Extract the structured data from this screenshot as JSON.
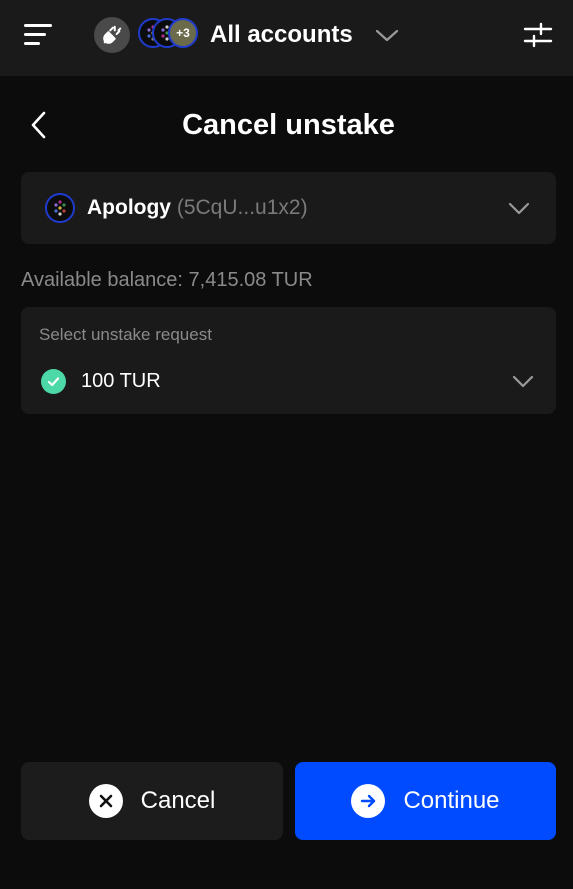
{
  "header": {
    "title": "All accounts",
    "more_accounts_badge": "+3",
    "icons": [
      "menu-icon",
      "plug-icon",
      "chevron-down-icon",
      "sliders-icon"
    ]
  },
  "page": {
    "title": "Cancel unstake"
  },
  "account": {
    "name": "Apology",
    "address": "(5CqU...u1x2)"
  },
  "balance": {
    "text": "Available balance: 7,415.08 TUR"
  },
  "unstake_request": {
    "label": "Select unstake request",
    "value": "100 TUR"
  },
  "buttons": {
    "cancel_label": "Cancel",
    "continue_label": "Continue"
  },
  "colors": {
    "background": "#0c0c0c",
    "panel": "#1a1a1a",
    "accent": "#004bff",
    "success": "#4cd9a7",
    "muted_text": "#8a8a8a"
  }
}
